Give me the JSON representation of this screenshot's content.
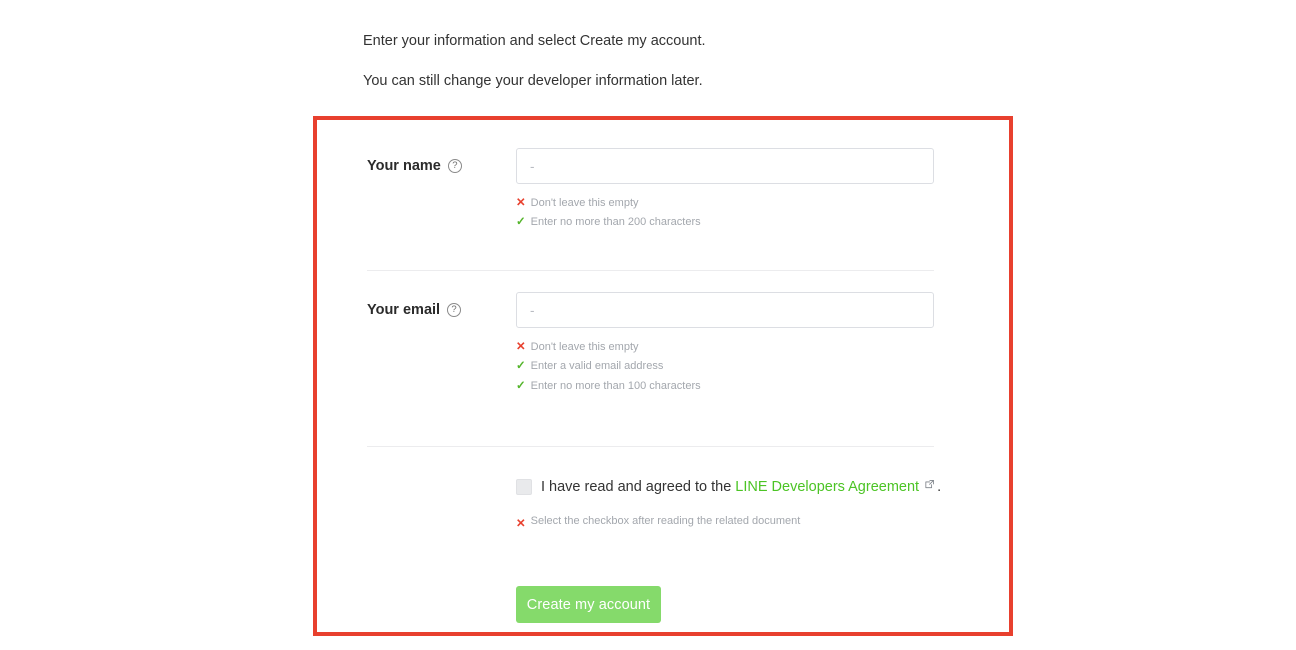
{
  "intro": {
    "line1": "Enter your information and select Create my account.",
    "line2": "You can still change your developer information later."
  },
  "form": {
    "fields": [
      {
        "label": "Your name",
        "help_icon": "help-circle-icon",
        "value": "",
        "placeholder": "-",
        "hints": [
          {
            "status": "error",
            "mark": "✕",
            "text": "Don't leave this empty"
          },
          {
            "status": "ok",
            "mark": "✓",
            "text": "Enter no more than 200 characters"
          }
        ]
      },
      {
        "label": "Your email",
        "help_icon": "help-circle-icon",
        "value": "",
        "placeholder": "-",
        "hints": [
          {
            "status": "error",
            "mark": "✕",
            "text": "Don't leave this empty"
          },
          {
            "status": "ok",
            "mark": "✓",
            "text": "Enter a valid email address"
          },
          {
            "status": "ok",
            "mark": "✓",
            "text": "Enter no more than 100 characters"
          }
        ]
      }
    ],
    "agreement": {
      "checked": false,
      "text_before": "I have read and agreed to the",
      "link_label": "LINE Developers Agreement",
      "external_icon": "external-link-icon",
      "text_after": ".",
      "error_mark": "✕",
      "error_text": "Select the checkbox after reading the related document"
    },
    "submit_label": "Create my account"
  },
  "colors": {
    "highlight_border": "#e8402e",
    "link_green": "#4cc425",
    "button_green": "#85da6b",
    "error_red": "#e8402e",
    "success_green": "#55b52c",
    "hint_text": "#a3a7ad"
  }
}
